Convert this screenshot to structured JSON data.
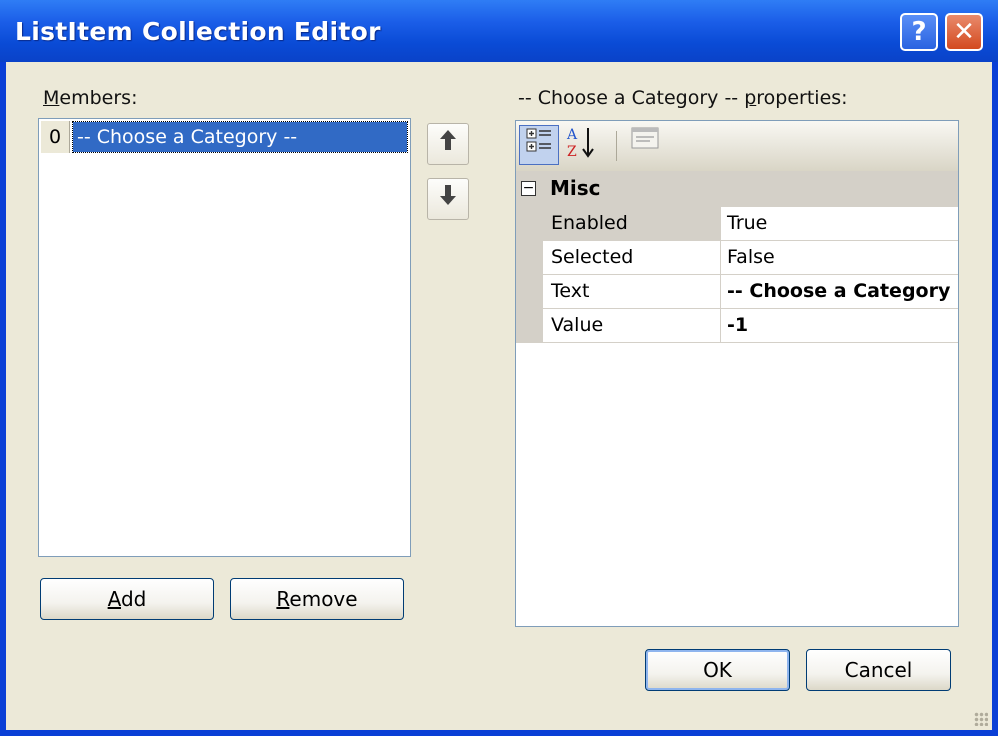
{
  "window": {
    "title": "ListItem Collection Editor",
    "help_label": "?",
    "close_label": "✕"
  },
  "members": {
    "label_prefix": "",
    "label_accel": "M",
    "label_rest": "embers:",
    "items": [
      {
        "index": "0",
        "text": "-- Choose a Category --"
      }
    ],
    "move_up_icon": "arrow-up-icon",
    "move_down_icon": "arrow-down-icon",
    "add_accel": "A",
    "add_rest": "dd",
    "remove_accel": "R",
    "remove_rest": "emove"
  },
  "properties": {
    "label_prefix": "-- Choose a Category -- ",
    "label_accel": "p",
    "label_rest": "roperties:",
    "toolbar": {
      "categorized_icon": "categorized-icon",
      "alphabetical_icon": "alphabetical-icon",
      "property_pages_icon": "property-pages-icon"
    },
    "category": {
      "toggle": "−",
      "name": "Misc"
    },
    "rows": [
      {
        "name": "Enabled",
        "value": "True"
      },
      {
        "name": "Selected",
        "value": "False"
      },
      {
        "name": "Text",
        "value": "-- Choose a Category --"
      },
      {
        "name": "Value",
        "value": "-1"
      }
    ]
  },
  "buttons": {
    "ok": "OK",
    "cancel": "Cancel"
  },
  "colors": {
    "titlebar": "#0a4bd6",
    "client": "#ece9d8",
    "selection": "#316ac5"
  }
}
